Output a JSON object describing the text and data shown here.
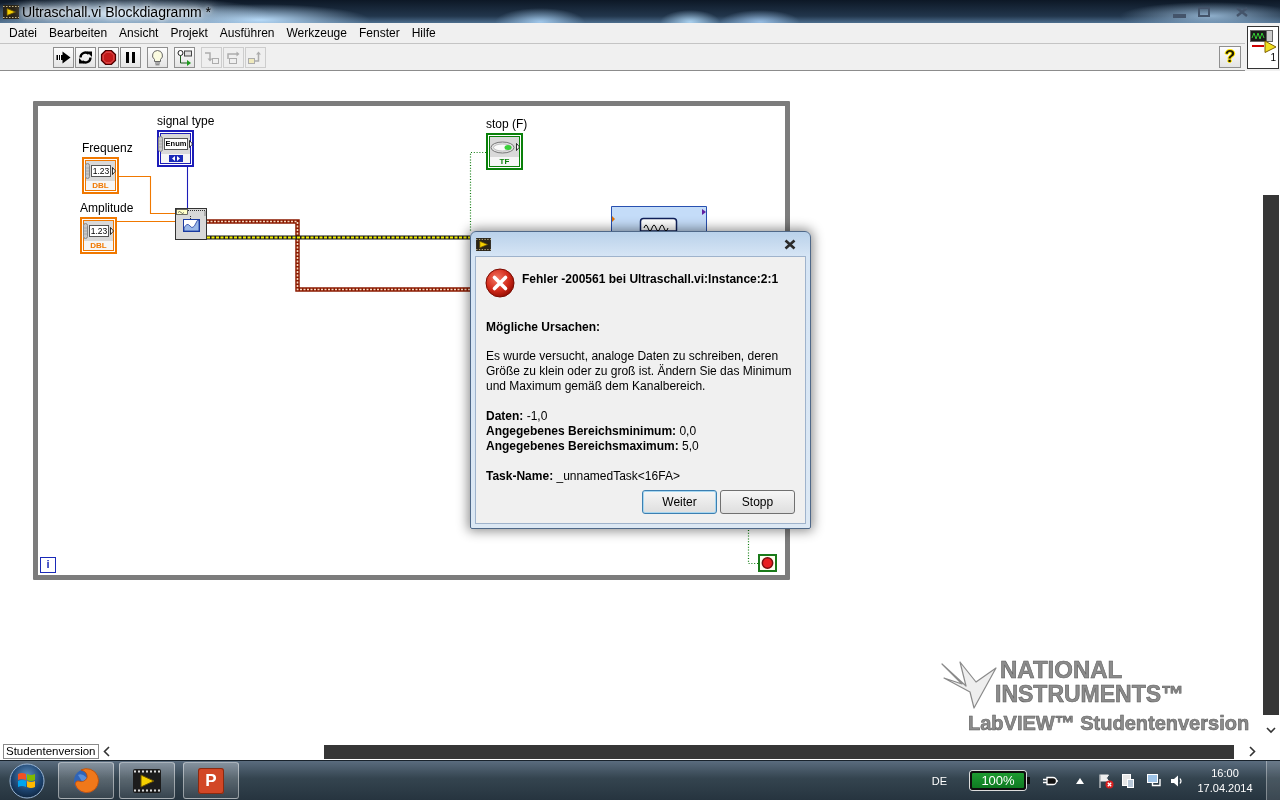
{
  "window": {
    "title": "Ultraschall.vi Blockdiagramm *"
  },
  "menu": [
    "Datei",
    "Bearbeiten",
    "Ansicht",
    "Projekt",
    "Ausführen",
    "Werkzeuge",
    "Fenster",
    "Hilfe"
  ],
  "toolbar": {
    "groups": [
      {
        "buttons": [
          {
            "kind": "run",
            "disabled": false
          },
          {
            "kind": "run-continuously",
            "disabled": false
          }
        ]
      },
      {
        "buttons": [
          {
            "kind": "abort",
            "disabled": false
          },
          {
            "kind": "pause",
            "disabled": false
          }
        ]
      },
      {
        "buttons": [
          {
            "kind": "highlight-execution",
            "disabled": false
          }
        ]
      },
      {
        "buttons": [
          {
            "kind": "retain-wire-values",
            "disabled": false
          }
        ]
      },
      {
        "buttons": [
          {
            "kind": "step-into",
            "disabled": true
          },
          {
            "kind": "step-over",
            "disabled": true
          },
          {
            "kind": "step-out",
            "disabled": true
          }
        ]
      }
    ],
    "help_button": {
      "glyph": "?"
    }
  },
  "vi_icon": {
    "connector_label": "1"
  },
  "diagram": {
    "terminals": [
      {
        "kind": "numeric",
        "label": "Frequenz",
        "value_glyph": "1.23",
        "type": "DBL"
      },
      {
        "kind": "numeric",
        "label": "Amplitude",
        "value_glyph": "1.23",
        "type": "DBL"
      },
      {
        "kind": "enum",
        "label": "signal type",
        "value_glyph": "Enum"
      },
      {
        "kind": "boolean",
        "label": "stop (F)",
        "type": "TF"
      }
    ],
    "iteration_terminal": {
      "glyph": "i"
    }
  },
  "error_dialog": {
    "heading": "Fehler -200561 bei Ultraschall.vi:Instance:2:1",
    "causes_heading": "Mögliche Ursachen:",
    "description": "Es wurde versucht, analoge Daten zu schreiben, deren Größe zu klein oder zu groß ist. Ändern Sie das Minimum und Maximum gemäß dem Kanalbereich.",
    "details": [
      "**Daten:** -1,0",
      "**Angegebenes Bereichsminimum:** 0,0",
      "**Angegebenes Bereichsmaximum:** 5,0"
    ],
    "task_name": "**Task-Name:** _unnamedTask<16FA>",
    "buttons": [
      {
        "label": "Weiter",
        "focused": true
      },
      {
        "label": "Stopp",
        "focused": false
      }
    ]
  },
  "student_edition_logo": {
    "lines": [
      "NATIONAL",
      "INSTRUMENTS™",
      "LabVIEW™ Studentenversion"
    ]
  },
  "status_label": "Studentenversion",
  "taskbar": {
    "apps": [
      {
        "kind": "browser"
      },
      {
        "kind": "labview"
      },
      {
        "kind": "presentation",
        "glyph": "P"
      }
    ],
    "language": "DE",
    "battery": "100%",
    "clock": {
      "time": "16:00",
      "date": "17.04.2014"
    }
  }
}
